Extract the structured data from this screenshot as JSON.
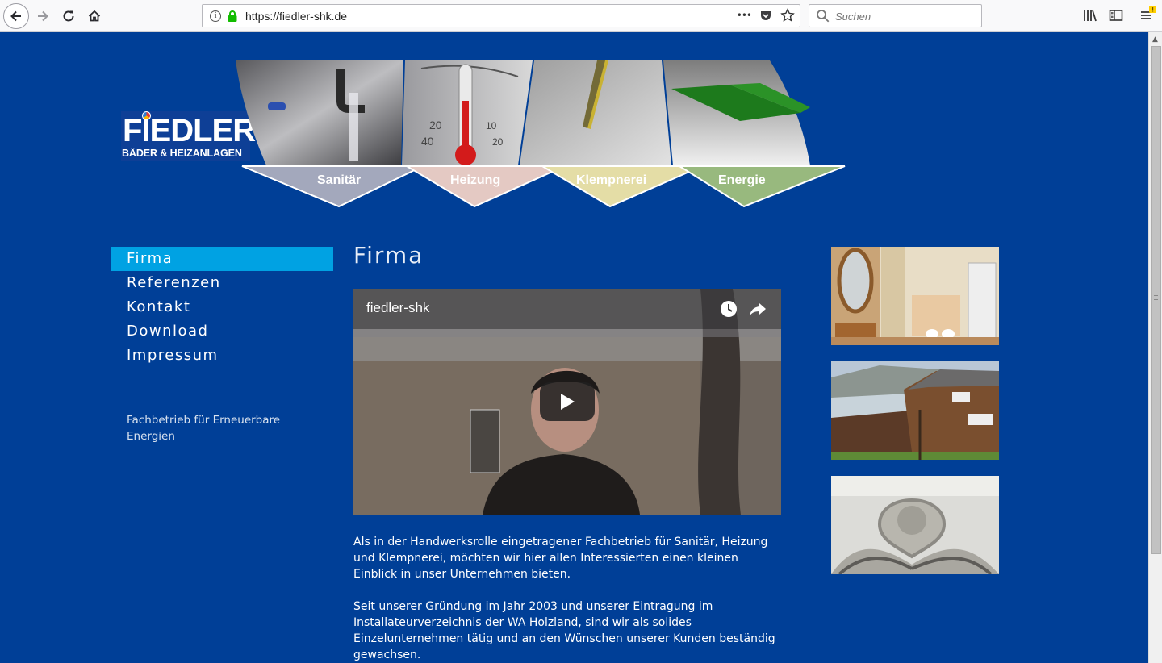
{
  "browser": {
    "url": "https://fiedler-shk.de",
    "search_placeholder": "Suchen",
    "url_info_glyph": "i",
    "more_glyph": "•••"
  },
  "logo": {
    "name": "FIEDLER",
    "subtitle": "BÄDER & HEIZANLAGEN"
  },
  "banner": {
    "sections": [
      "Sanitär",
      "Heizung",
      "Klempnerei",
      "Energie"
    ],
    "colors": [
      "#a3a8bc",
      "#e4c9c3",
      "#e4dda6",
      "#98b97e"
    ]
  },
  "nav": {
    "items": [
      "Firma",
      "Referenzen",
      "Kontakt",
      "Download",
      "Impressum"
    ],
    "active_index": 0
  },
  "sidebar_note": "Fachbetrieb für Erneuerbare Energien",
  "main": {
    "title": "Firma",
    "video": {
      "title": "fiedler-shk"
    },
    "paragraphs": [
      "Als in der Handwerksrolle eingetragener Fachbetrieb für Sanitär, Heizung und Klempnerei, möchten wir hier allen Interessierten einen kleinen Einblick in unser Unternehmen bieten.",
      "Seit unserer Gründung im Jahr 2003 und unserer Eintragung im Installateurverzeichnis der WA Holzland, sind wir als solides Einzelunternehmen tätig und an den Wünschen unserer Kunden beständig gewachsen."
    ]
  },
  "colors": {
    "page_bg": "#003f97",
    "nav_active": "#00a2e3"
  }
}
